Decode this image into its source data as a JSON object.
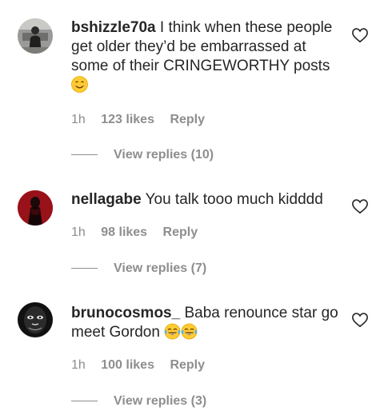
{
  "comments": [
    {
      "username": "bshizzle70a",
      "text": "I think when these people get older they’d be embarrassed at some of their CRINGEWORTHY posts",
      "emoji": "smiling-face-emoji",
      "time": "1h",
      "likes": "123 likes",
      "reply": "Reply",
      "view_replies": "View replies (10)"
    },
    {
      "username": "nellagabe",
      "text": "You talk tooo much kidddd",
      "time": "1h",
      "likes": "98 likes",
      "reply": "Reply",
      "view_replies": "View replies (7)"
    },
    {
      "username": "brunocosmos_",
      "text": "Baba renounce star go meet Gordon",
      "emoji": "tears-of-joy-emoji",
      "time": "1h",
      "likes": "100 likes",
      "reply": "Reply",
      "view_replies": "View replies (3)"
    }
  ],
  "icons": {
    "like": "heart-outline-icon"
  },
  "colors": {
    "text": "#262626",
    "secondary": "#8e8e8e",
    "emoji": "#ffcc33"
  }
}
